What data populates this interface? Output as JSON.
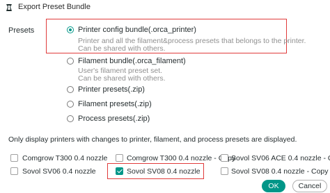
{
  "window": {
    "title": "Export Preset Bundle",
    "icon": "orca-slicer-logo-icon"
  },
  "presets_label": "Presets",
  "options": [
    {
      "label": "Printer config bundle(.orca_printer)",
      "checked": true,
      "desc1": "Printer and all the filament&process presets that belongs to the printer.",
      "desc2": "Can be shared with others."
    },
    {
      "label": "Filament bundle(.orca_filament)",
      "checked": false,
      "desc1": "User's filament preset set.",
      "desc2": "Can be shared with others."
    },
    {
      "label": "Printer presets(.zip)",
      "checked": false
    },
    {
      "label": "Filament presets(.zip)",
      "checked": false
    },
    {
      "label": "Process presets(.zip)",
      "checked": false
    }
  ],
  "note": "Only display printers with changes to printer, filament, and process presets are displayed.",
  "printers": [
    {
      "label": "Comgrow T300 0.4 nozzle",
      "checked": false
    },
    {
      "label": "Comgrow T300 0.4 nozzle - Copy",
      "checked": false
    },
    {
      "label": "Sovol SV06 ACE 0.4 nozzle - Copy",
      "checked": false
    },
    {
      "label": "Sovol SV06 0.4 nozzle",
      "checked": false
    },
    {
      "label": "Sovol SV08 0.4 nozzle",
      "checked": true
    },
    {
      "label": "Sovol SV08 0.4 nozzle - Copy",
      "checked": false
    }
  ],
  "buttons": {
    "ok": "OK",
    "cancel": "Cancel"
  },
  "colors": {
    "accent": "#009688",
    "highlight": "#e03b3b"
  }
}
